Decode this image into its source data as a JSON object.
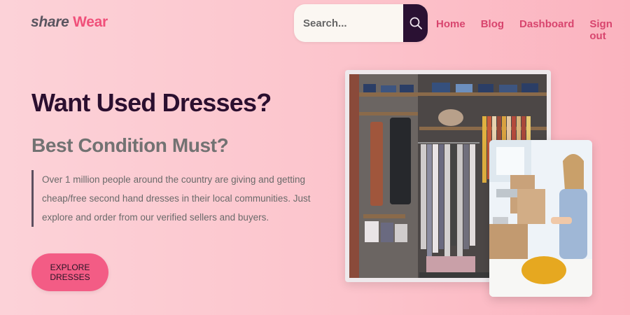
{
  "brand": {
    "part1": "share",
    "part2": "Wear"
  },
  "search": {
    "placeholder": "Search..."
  },
  "nav": {
    "home": "Home",
    "blog": "Blog",
    "dashboard": "Dashboard",
    "signout": "Sign out"
  },
  "hero": {
    "title": "Want Used Dresses?",
    "subtitle": "Best Condition Must?",
    "description": "Over 1 million people around the country are giving and getting cheap/free second hand dresses in their local communities. Just explore and order from our verified sellers and buyers.",
    "cta": "EXPLORE DRESSES"
  },
  "icons": {
    "search": "magnifier-icon"
  },
  "colors": {
    "brand_pink": "#f0507a",
    "nav": "#d8456e",
    "dark": "#2a1133",
    "cta": "#f35c85"
  }
}
